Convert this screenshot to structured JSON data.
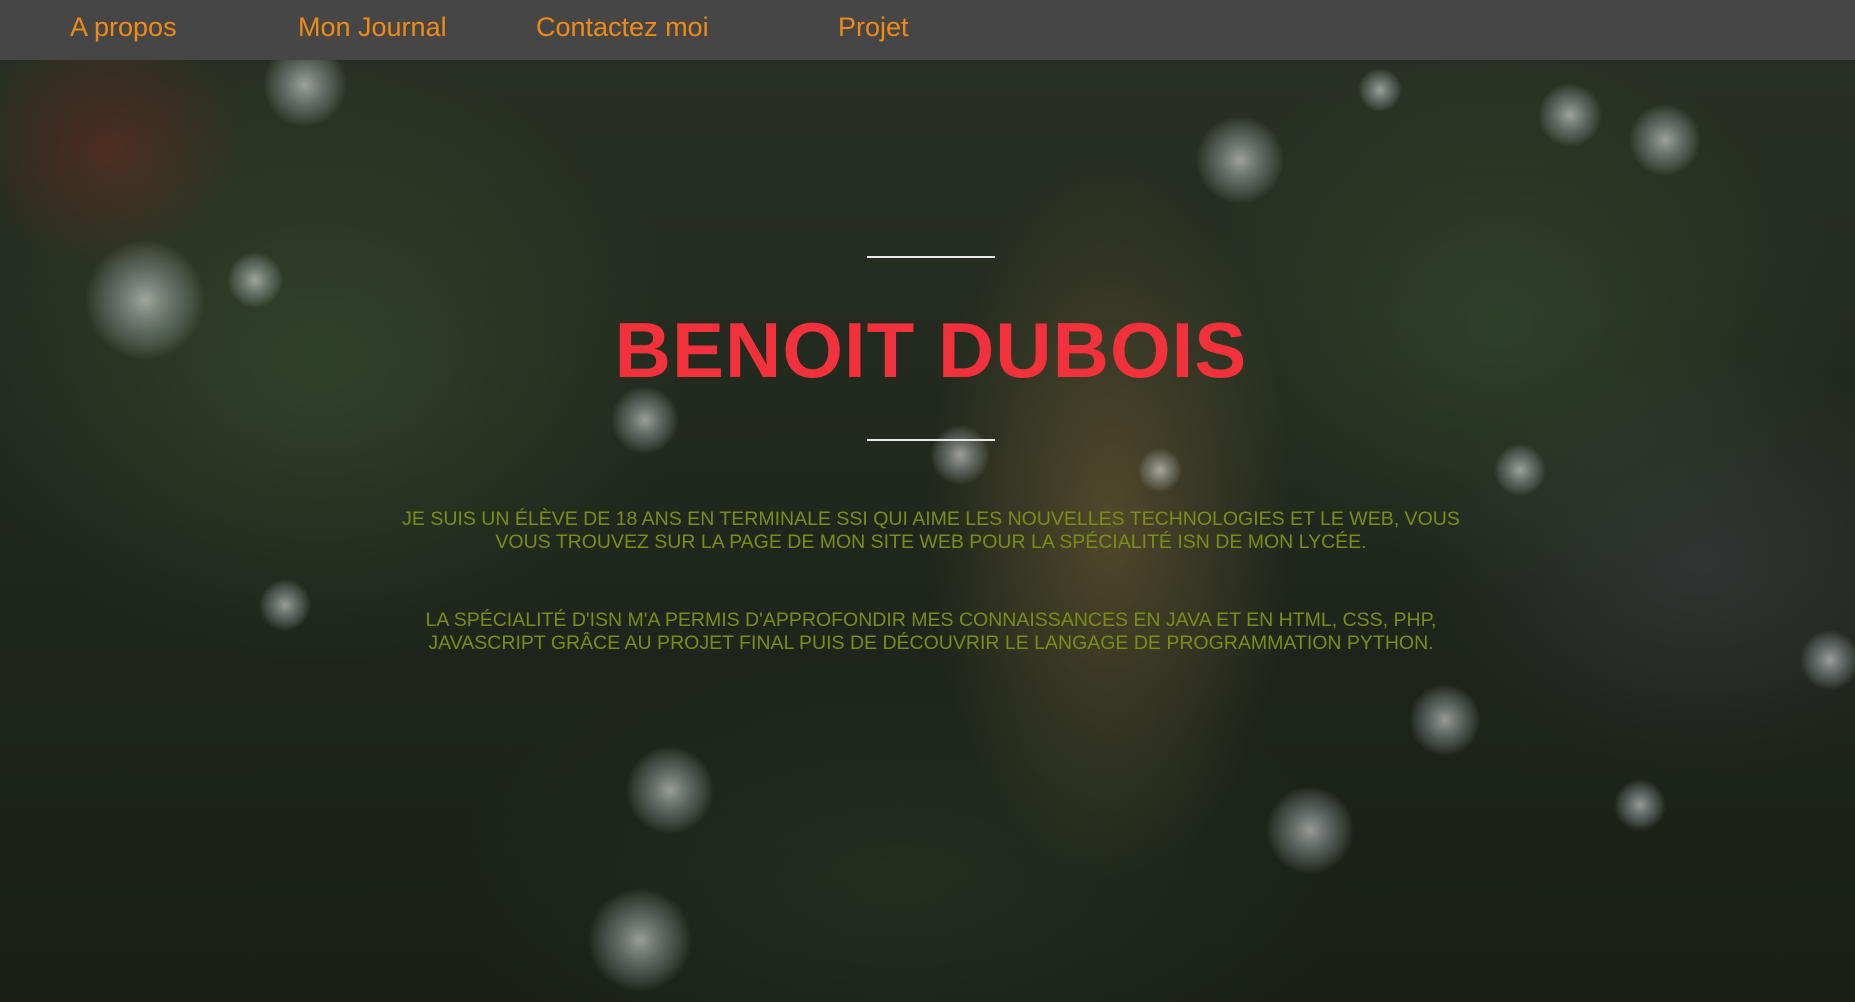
{
  "nav": {
    "items": [
      {
        "label": "A propos"
      },
      {
        "label": "Mon Journal"
      },
      {
        "label": "Contactez moi"
      },
      {
        "label": "Projet"
      }
    ]
  },
  "hero": {
    "title": "BENOIT DUBOIS",
    "paragraph1": {
      "line1": "JE SUIS UN ÉLÈVE DE 18 ANS EN TERMINALE SSI QUI AIME LES NOUVELLES TECHNOLOGIES ET LE WEB, VOUS",
      "line2": "VOUS TROUVEZ SUR LA PAGE DE MON SITE WEB POUR LA SPÉCIALITÉ ISN DE MON LYCÉE."
    },
    "paragraph2": {
      "line1": "LA SPÉCIALITÉ D'ISN M'A PERMIS D'APPROFONDIR MES CONNAISSANCES EN JAVA ET EN HTML, CSS, PHP,",
      "line2": "JAVASCRIPT GRÂCE AU PROJET FINAL PUIS DE DÉCOUVRIR LE LANGAGE DE PROGRAMMATION PYTHON."
    }
  },
  "colors": {
    "nav_background": "#464646",
    "nav_text": "#f08a16",
    "title": "#f1313c",
    "body_text": "#7b8e14",
    "rule": "#e8e8e8"
  }
}
